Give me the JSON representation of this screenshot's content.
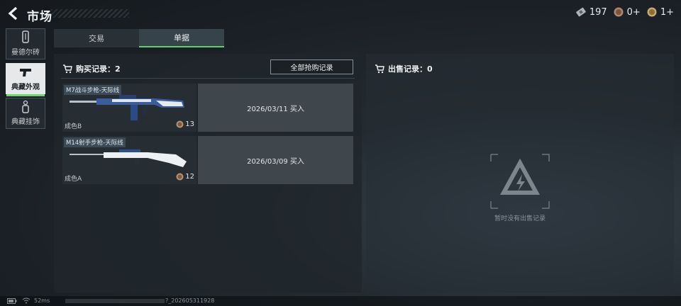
{
  "header": {
    "title": "市场",
    "currencies": [
      {
        "icon": "ticket-icon",
        "value": "197"
      },
      {
        "icon": "medal-bronze-icon",
        "value": "0+"
      },
      {
        "icon": "medal-gold-icon",
        "value": "1+"
      }
    ]
  },
  "sidebar": {
    "items": [
      {
        "label": "曼德尔砖",
        "icon": "brick-icon",
        "active": false
      },
      {
        "label": "典藏外观",
        "icon": "pistol-icon",
        "active": true
      },
      {
        "label": "典藏挂饰",
        "icon": "charm-icon",
        "active": false
      }
    ]
  },
  "tabs": [
    {
      "label": "交易",
      "active": false
    },
    {
      "label": "单据",
      "active": true
    }
  ],
  "buy_panel": {
    "title": "购买记录：2",
    "buy_all_label": "全部抢购记录",
    "records": [
      {
        "name": "M7战斗步枪-天际线",
        "grade": "成色B",
        "price": "13",
        "date": "2026/03/11 买入"
      },
      {
        "name": "M14射手步枪-天际线",
        "grade": "成色A",
        "price": "12",
        "date": "2026/03/09 买入"
      }
    ]
  },
  "sell_panel": {
    "title": "出售记录：0",
    "empty_text": "暂时没有出售记录"
  },
  "footer": {
    "ping": "52ms",
    "build": "?_202605311928"
  },
  "colors": {
    "accent_green": "#5fd16a",
    "panel_bg": "#20262b",
    "date_bg": "#3f474d"
  }
}
